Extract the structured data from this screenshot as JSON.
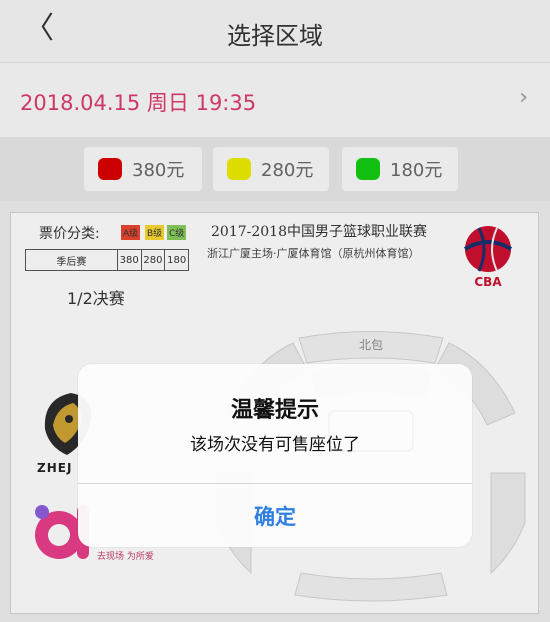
{
  "nav": {
    "back_icon": "chevron-left-icon",
    "back_glyph": "〈",
    "title": "选择区域"
  },
  "datebar": {
    "date": "2018.04.15 周日 19:35",
    "chevron": "›"
  },
  "prices": [
    {
      "label": "380元",
      "color": "#d60000"
    },
    {
      "label": "280元",
      "color": "#e6e600"
    },
    {
      "label": "180元",
      "color": "#12c812"
    }
  ],
  "map": {
    "legend_label": "票价分类:",
    "levels": [
      {
        "label": "A级",
        "color": "#e3442e"
      },
      {
        "label": "B级",
        "color": "#f2d230"
      },
      {
        "label": "C级",
        "color": "#84c85a"
      }
    ],
    "price_table": {
      "name": "季后赛",
      "values": [
        "380",
        "280",
        "180"
      ]
    },
    "round": "1/2决赛",
    "event_name": "2017-2018中国男子篮球职业联赛",
    "venue": "浙江广厦主场·广厦体育馆（原杭州体育馆）",
    "cba_text": "CBA",
    "team_text": "ZHEJ",
    "slogan": "去现场 为所爱",
    "arena_top_label": "北包"
  },
  "dialog": {
    "title": "温馨提示",
    "message": "该场次没有可售座位了",
    "ok_label": "确定"
  }
}
